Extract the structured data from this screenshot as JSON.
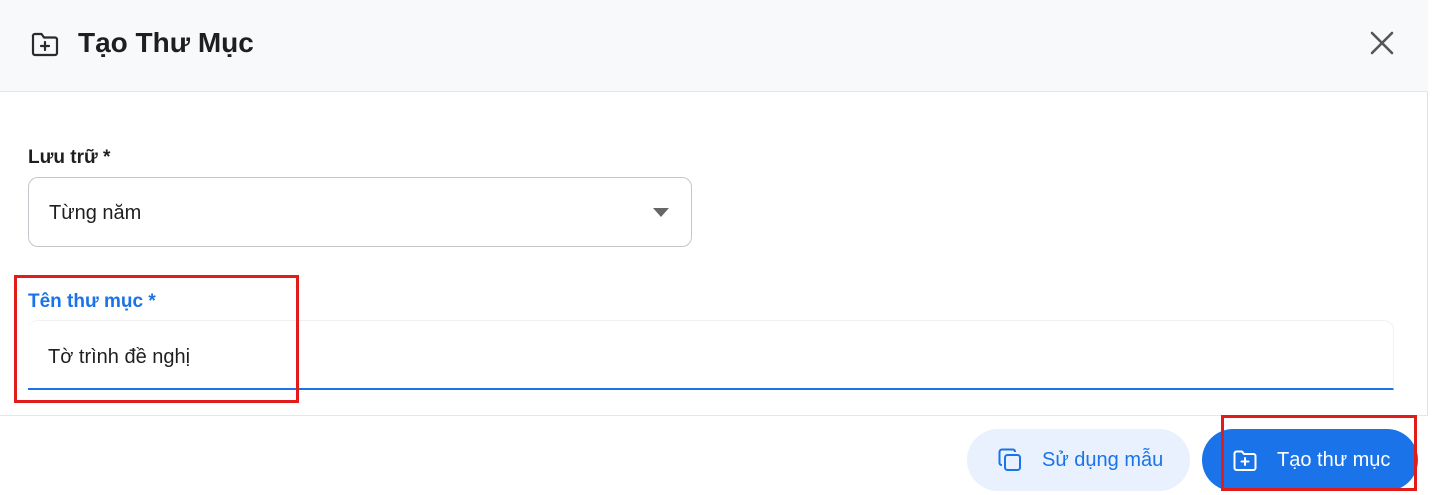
{
  "dialog": {
    "title": "Tạo Thư Mục",
    "header_icon": "folder-plus-icon",
    "close_icon": "close-icon"
  },
  "form": {
    "storage": {
      "label": "Lưu trữ *",
      "value": "Từng năm"
    },
    "folder_name": {
      "label": "Tên thư mục *",
      "value": "Tờ trình đề nghị"
    }
  },
  "footer": {
    "use_template": {
      "label": "Sử dụng mẫu",
      "icon": "copy-icon"
    },
    "create_folder": {
      "label": "Tạo thư mục",
      "icon": "folder-plus-icon"
    }
  },
  "colors": {
    "accent": "#1a73e8",
    "accent_light": "#e8f1fd",
    "highlight": "#e21b1b",
    "header_bg": "#f8f9fb"
  }
}
